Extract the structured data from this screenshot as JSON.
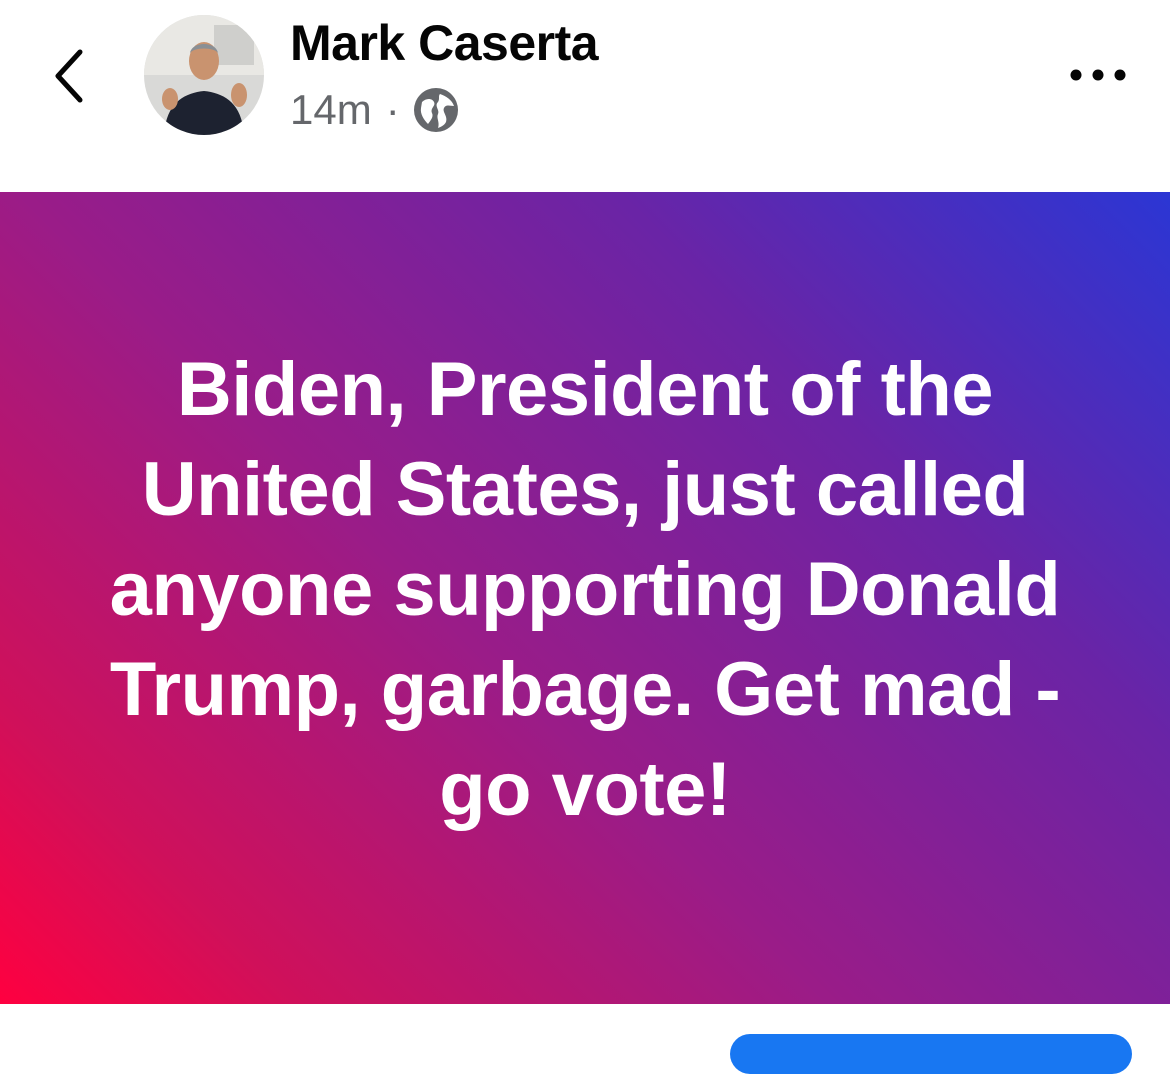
{
  "header": {
    "author_name": "Mark Caserta",
    "timestamp": "14m",
    "separator": "·",
    "audience_icon": "globe-icon",
    "back_icon": "chevron-left-icon",
    "more_icon": "more-horizontal-icon"
  },
  "post": {
    "text": "Biden, President of the United States, just called anyone supporting Donald Trump, garbage. Get mad - go vote!",
    "background_colors": [
      "#2b36d4",
      "#6a24a6",
      "#9a1c88",
      "#d0105a",
      "#ff0040"
    ]
  },
  "colors": {
    "name": "#050505",
    "meta": "#65676b",
    "accent": "#1877f2"
  }
}
